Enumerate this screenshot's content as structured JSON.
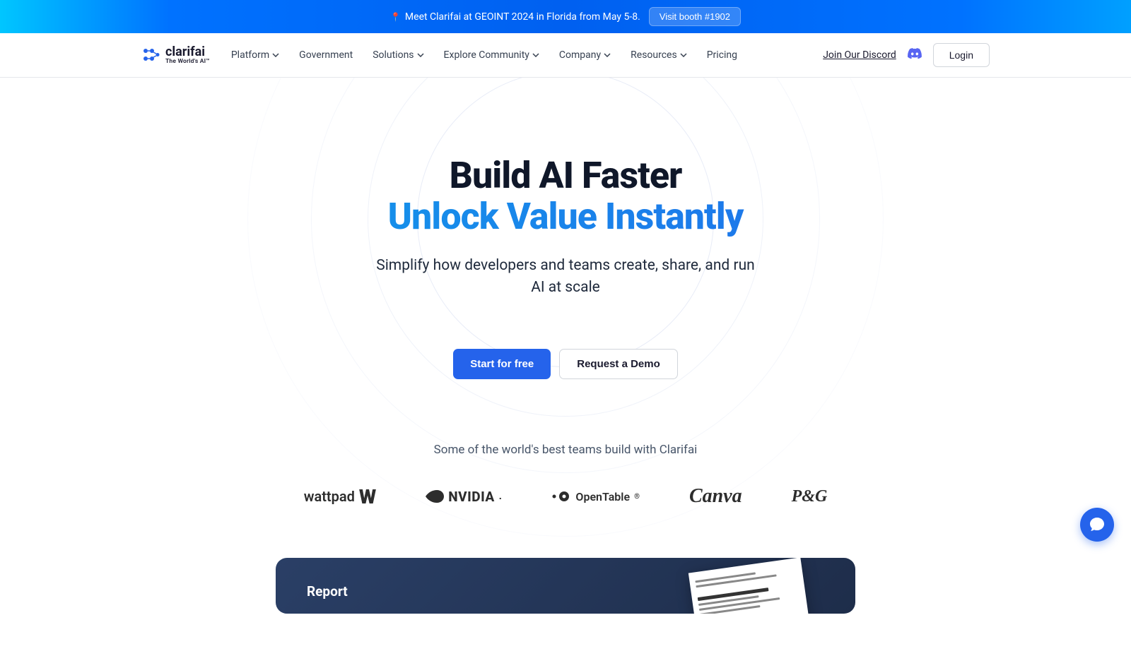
{
  "announcement": {
    "text": "Meet Clarifai at GEOINT 2024 in Florida from May 5-8.",
    "button": "Visit booth #1902"
  },
  "logo": {
    "name": "clarifai",
    "tagline": "The World's AI™"
  },
  "nav": {
    "items": [
      {
        "label": "Platform",
        "hasDropdown": true
      },
      {
        "label": "Government",
        "hasDropdown": false
      },
      {
        "label": "Solutions",
        "hasDropdown": true
      },
      {
        "label": "Explore Community",
        "hasDropdown": true
      },
      {
        "label": "Company",
        "hasDropdown": true
      },
      {
        "label": "Resources",
        "hasDropdown": true
      },
      {
        "label": "Pricing",
        "hasDropdown": false
      }
    ]
  },
  "header_right": {
    "discord": "Join Our Discord",
    "login": "Login"
  },
  "hero": {
    "title1": "Build AI Faster",
    "title2": "Unlock Value Instantly",
    "subtitle": "Simplify how developers and teams create, share, and run AI at scale",
    "cta_primary": "Start for free",
    "cta_secondary": "Request a Demo"
  },
  "social_proof": {
    "label": "Some of the world's best teams build with Clarifai",
    "brands": [
      "wattpad",
      "NVIDIA",
      "OpenTable",
      "Canva",
      "P&G"
    ]
  },
  "report": {
    "label": "Report"
  }
}
